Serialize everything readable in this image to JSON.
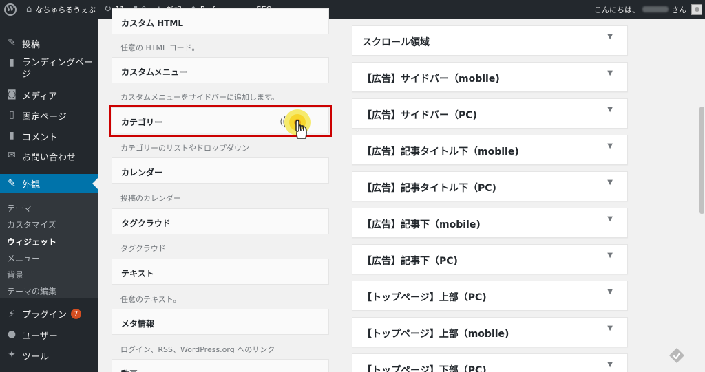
{
  "adminbar": {
    "wp_logo_glyph": "W",
    "site_name": "なちゅらるうぇぶ",
    "updates_count": "11",
    "comments_count": "0",
    "new_label": "新規",
    "performance_label": "Performance",
    "seo_label": "SEO",
    "greeting_prefix": "こんにちは、",
    "greeting_suffix": "さん"
  },
  "menu": {
    "posts": "投稿",
    "landing_pages": "ランディングページ",
    "media": "メディア",
    "pages": "固定ページ",
    "comments": "コメント",
    "contact": "お問い合わせ",
    "appearance": "外観",
    "plugins": "プラグイン",
    "plugins_badge": "7",
    "users": "ユーザー",
    "tools": "ツール"
  },
  "submenu": {
    "themes": "テーマ",
    "customize": "カスタマイズ",
    "widgets": "ウィジェット",
    "menus": "メニュー",
    "background": "背景",
    "theme_editor": "テーマの編集"
  },
  "widgets": [
    {
      "title": "カスタム HTML",
      "desc": "任意の HTML コード。"
    },
    {
      "title": "カスタムメニュー",
      "desc": "カスタムメニューをサイドバーに追加します。"
    },
    {
      "title": "カテゴリー",
      "desc": "カテゴリーのリストやドロップダウン"
    },
    {
      "title": "カレンダー",
      "desc": "投稿のカレンダー"
    },
    {
      "title": "タグクラウド",
      "desc": "タグクラウド"
    },
    {
      "title": "テキスト",
      "desc": "任意のテキスト。"
    },
    {
      "title": "メタ情報",
      "desc": "ログイン、RSS、WordPress.org へのリンク"
    },
    {
      "title": "動画",
      "desc": ""
    }
  ],
  "sidebars": [
    "スクロール領域",
    "【広告】サイドバー（mobile)",
    "【広告】サイドバー（PC)",
    "【広告】記事タイトル下（mobile)",
    "【広告】記事タイトル下（PC)",
    "【広告】記事下（mobile)",
    "【広告】記事下（PC)",
    "【トップページ】上部（PC)",
    "【トップページ】上部（mobile)",
    "【トップページ】下部（PC)"
  ],
  "toggle_glyph": "▼",
  "colors": {
    "admin_bg": "#23282d",
    "accent": "#0073aa",
    "highlight": "#cc0000",
    "badge": "#d54e21"
  }
}
